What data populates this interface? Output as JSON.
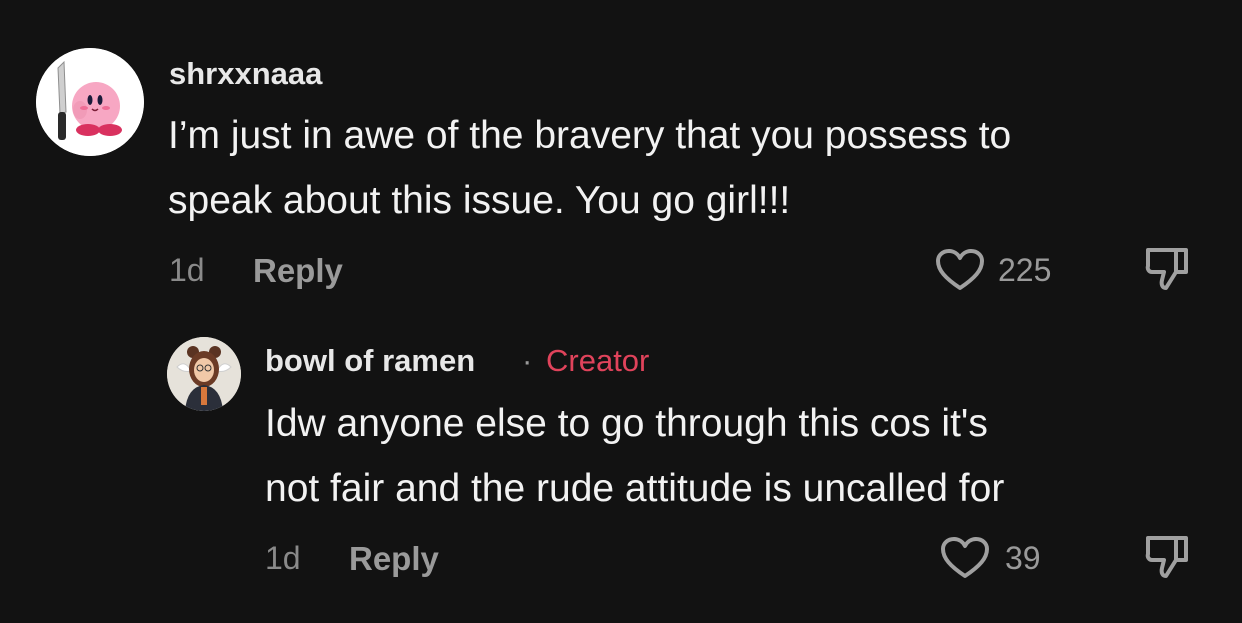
{
  "comments": [
    {
      "username": "shrxxnaaa",
      "text_line1": "I’m just in awe of the bravery that you possess to",
      "text_line2": "speak about this issue. You go girl!!!",
      "time": "1d",
      "reply_label": "Reply",
      "likes": "225"
    }
  ],
  "reply": {
    "username": "bowl of ramen",
    "separator": "·",
    "badge": "Creator",
    "text_line1": "Idw anyone else to go through this cos it's",
    "text_line2": "not fair and the rude attitude is uncalled for",
    "time": "1d",
    "reply_label": "Reply",
    "likes": "39"
  },
  "colors": {
    "background": "#121212",
    "creator_badge": "#e0435b",
    "muted_text": "#8a8a8a"
  },
  "icons": [
    "heart-outline-icon",
    "thumbs-down-icon"
  ]
}
